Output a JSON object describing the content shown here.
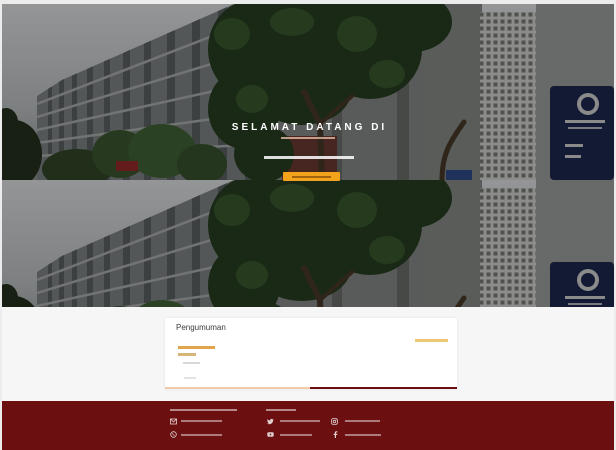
{
  "brand": {
    "colors": {
      "primary": "#6b0f10",
      "accent": "#f2a31b",
      "accent_soft": "#f3c9a8"
    }
  },
  "hero": {
    "title": "SELAMAT DATANG DI"
  },
  "announcements": {
    "title": "Pengumuman"
  },
  "footer": {
    "contact_icons": [
      "envelope-icon",
      "phone-icon"
    ],
    "social_icons": [
      "twitter-icon",
      "youtube-icon",
      "instagram-icon",
      "facebook-icon"
    ]
  }
}
